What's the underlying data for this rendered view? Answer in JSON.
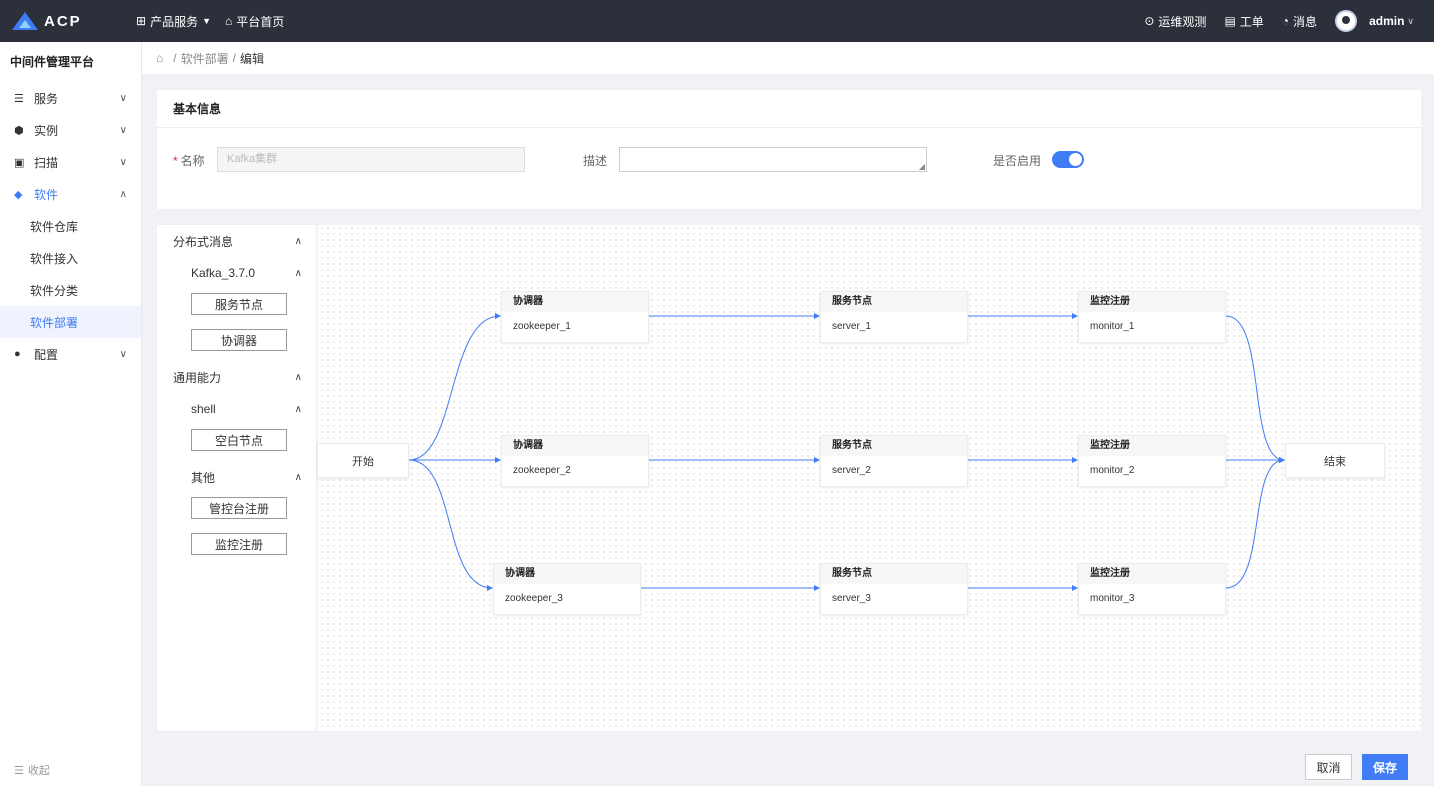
{
  "topbar": {
    "logo_text": "ACP",
    "nav": [
      {
        "label": "产品服务",
        "icon": "grid-icon"
      },
      {
        "label": "平台首页",
        "icon": "home-icon"
      }
    ],
    "right": [
      {
        "label": "运维观测",
        "icon": "location-icon"
      },
      {
        "label": "工单",
        "icon": "clipboard-icon"
      },
      {
        "label": "消息",
        "icon": "bell-icon"
      }
    ],
    "user": "admin"
  },
  "sidebar": {
    "title": "中间件管理平台",
    "items": [
      {
        "label": "服务",
        "icon": "server-icon"
      },
      {
        "label": "实例",
        "icon": "cube-icon"
      },
      {
        "label": "扫描",
        "icon": "scan-icon"
      },
      {
        "label": "软件",
        "icon": "box-icon",
        "children": [
          "软件仓库",
          "软件接入",
          "软件分类",
          "软件部署"
        ]
      },
      {
        "label": "配置",
        "icon": "settings-icon"
      }
    ],
    "collapse_label": "收起"
  },
  "breadcrumb": {
    "sep": "/",
    "parent": "软件部署",
    "current": "编辑"
  },
  "basic_info": {
    "title": "基本信息",
    "name_label": "名称",
    "name_value": "Kafka集群",
    "desc_label": "描述",
    "enabled_label": "是否启用",
    "enabled": true
  },
  "palette": {
    "group1": "分布式消息",
    "group1_sub": "Kafka_3.7.0",
    "group1_btns": [
      "服务节点",
      "协调器"
    ],
    "group2": "通用能力",
    "group2_sub1": "shell",
    "group2_sub1_btns": [
      "空白节点"
    ],
    "group2_sub2": "其他",
    "group2_sub2_btns": [
      "管控台注册",
      "监控注册"
    ]
  },
  "flow": {
    "start": "开始",
    "end": "结束",
    "rows": [
      {
        "coordinator": {
          "title": "协调器",
          "name": "zookeeper_1"
        },
        "server": {
          "title": "服务节点",
          "name": "server_1"
        },
        "monitor": {
          "title": "监控注册",
          "name": "monitor_1"
        }
      },
      {
        "coordinator": {
          "title": "协调器",
          "name": "zookeeper_2"
        },
        "server": {
          "title": "服务节点",
          "name": "server_2"
        },
        "monitor": {
          "title": "监控注册",
          "name": "monitor_2"
        }
      },
      {
        "coordinator": {
          "title": "协调器",
          "name": "zookeeper_3"
        },
        "server": {
          "title": "服务节点",
          "name": "server_3"
        },
        "monitor": {
          "title": "监控注册",
          "name": "monitor_3"
        }
      }
    ],
    "edge_color": "#3f7cf6"
  },
  "footer": {
    "cancel": "取消",
    "save": "保存"
  },
  "colors": {
    "accent": "#3f7cf6",
    "topbar": "#2b303b"
  }
}
